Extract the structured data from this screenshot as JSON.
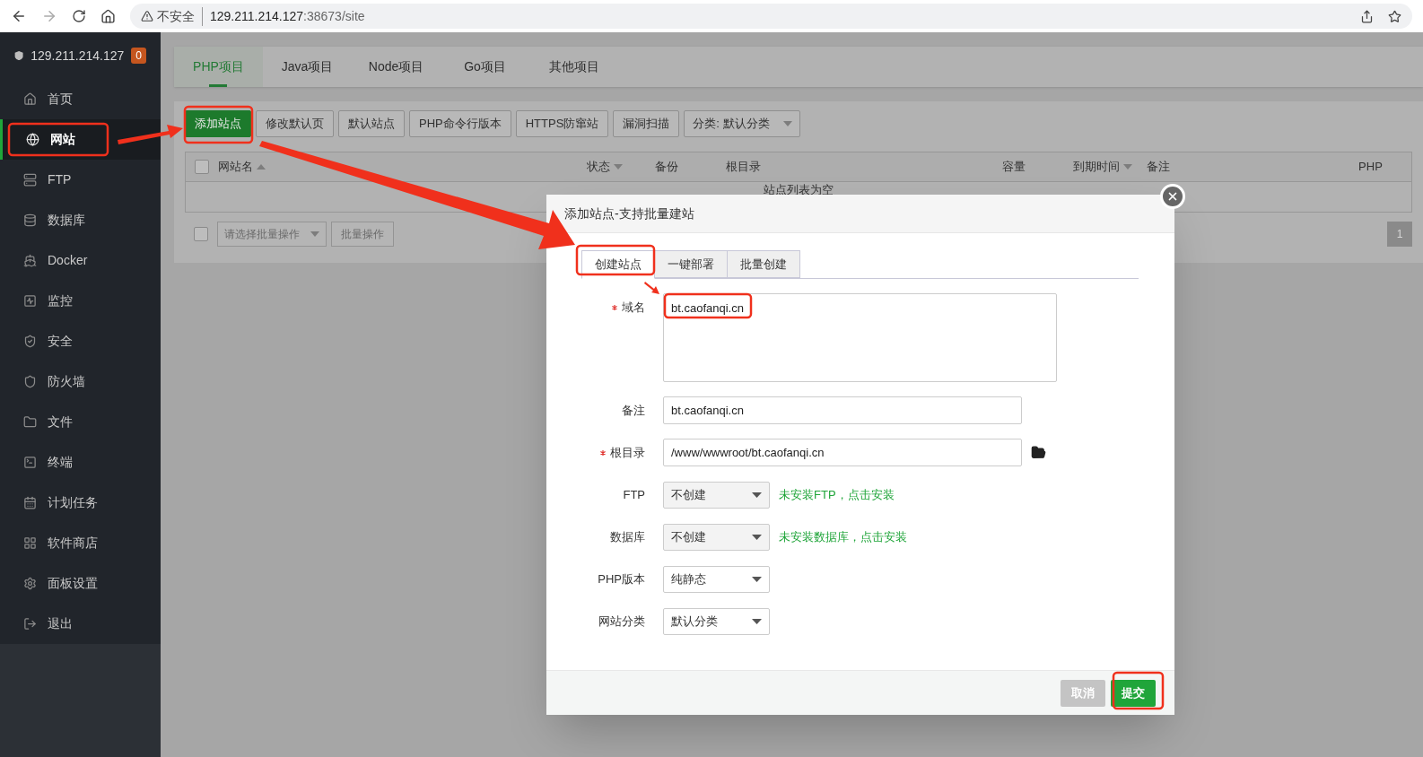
{
  "browser": {
    "security": "不安全",
    "host": "129.211.214.127",
    "path": ":38673/site"
  },
  "sidebar": {
    "title": "129.211.214.127",
    "badge": "0",
    "items": [
      {
        "label": "首页",
        "selected": false
      },
      {
        "label": "网站",
        "selected": true
      },
      {
        "label": "FTP",
        "selected": false
      },
      {
        "label": "数据库",
        "selected": false
      },
      {
        "label": "Docker",
        "selected": false
      },
      {
        "label": "监控",
        "selected": false
      },
      {
        "label": "安全",
        "selected": false
      },
      {
        "label": "防火墙",
        "selected": false
      },
      {
        "label": "文件",
        "selected": false
      },
      {
        "label": "终端",
        "selected": false
      },
      {
        "label": "计划任务",
        "selected": false
      },
      {
        "label": "软件商店",
        "selected": false
      },
      {
        "label": "面板设置",
        "selected": false
      },
      {
        "label": "退出",
        "selected": false
      }
    ]
  },
  "tabs": [
    {
      "label": "PHP项目",
      "selected": true
    },
    {
      "label": "Java项目",
      "selected": false
    },
    {
      "label": "Node项目",
      "selected": false
    },
    {
      "label": "Go项目",
      "selected": false
    },
    {
      "label": "其他项目",
      "selected": false
    }
  ],
  "toolbar": {
    "buttons": [
      {
        "label": "添加站点",
        "kind": "primary"
      },
      {
        "label": "修改默认页",
        "kind": "default"
      },
      {
        "label": "默认站点",
        "kind": "default"
      },
      {
        "label": "PHP命令行版本",
        "kind": "default"
      },
      {
        "label": "HTTPS防窜站",
        "kind": "default"
      },
      {
        "label": "漏洞扫描",
        "kind": "default"
      }
    ],
    "category": "分类: 默认分类"
  },
  "table": {
    "columns": [
      {
        "label": "网站名",
        "sorted": true,
        "ascending": true
      },
      {
        "label": "状态",
        "sorted": true,
        "ascending": false
      },
      {
        "label": "备份",
        "sorted": false
      },
      {
        "label": "根目录",
        "sorted": false
      },
      {
        "label": "容量",
        "sorted": false
      },
      {
        "label": "到期时间",
        "sorted": true,
        "ascending": false
      },
      {
        "label": "备注",
        "sorted": false
      },
      {
        "label": "PHP",
        "sorted": false
      }
    ],
    "select_all_checked": false,
    "empty_text": "站点列表为空"
  },
  "batch": {
    "checked": false,
    "placeholder": "请选择批量操作",
    "button": "批量操作"
  },
  "pagination": [
    "1"
  ],
  "modal": {
    "title": "添加站点-支持批量建站",
    "tabs": [
      {
        "label": "创建站点",
        "selected": true
      },
      {
        "label": "一键部署",
        "selected": false
      },
      {
        "label": "批量创建",
        "selected": false
      }
    ],
    "fields": [
      {
        "label": "域名",
        "required": true,
        "kind": "textarea",
        "value": "bt.caofanqi.cn"
      },
      {
        "label": "备注",
        "required": false,
        "kind": "input",
        "value": "bt.caofanqi.cn"
      },
      {
        "label": "根目录",
        "required": true,
        "kind": "folder",
        "value": "/www/wwwroot/bt.caofanqi.cn"
      },
      {
        "label": "FTP",
        "required": false,
        "kind": "select",
        "value": "不创建",
        "disabled": true,
        "hint": "未安装FTP，点击安装"
      },
      {
        "label": "数据库",
        "required": false,
        "kind": "select",
        "value": "不创建",
        "disabled": true,
        "hint": "未安装数据库，点击安装"
      },
      {
        "label": "PHP版本",
        "required": false,
        "kind": "select",
        "value": "纯静态",
        "disabled": false
      },
      {
        "label": "网站分类",
        "required": false,
        "kind": "select",
        "value": "默认分类",
        "disabled": false
      }
    ],
    "buttons": [
      {
        "label": "取消",
        "kind": "secondary"
      },
      {
        "label": "提交",
        "kind": "primary"
      }
    ]
  }
}
